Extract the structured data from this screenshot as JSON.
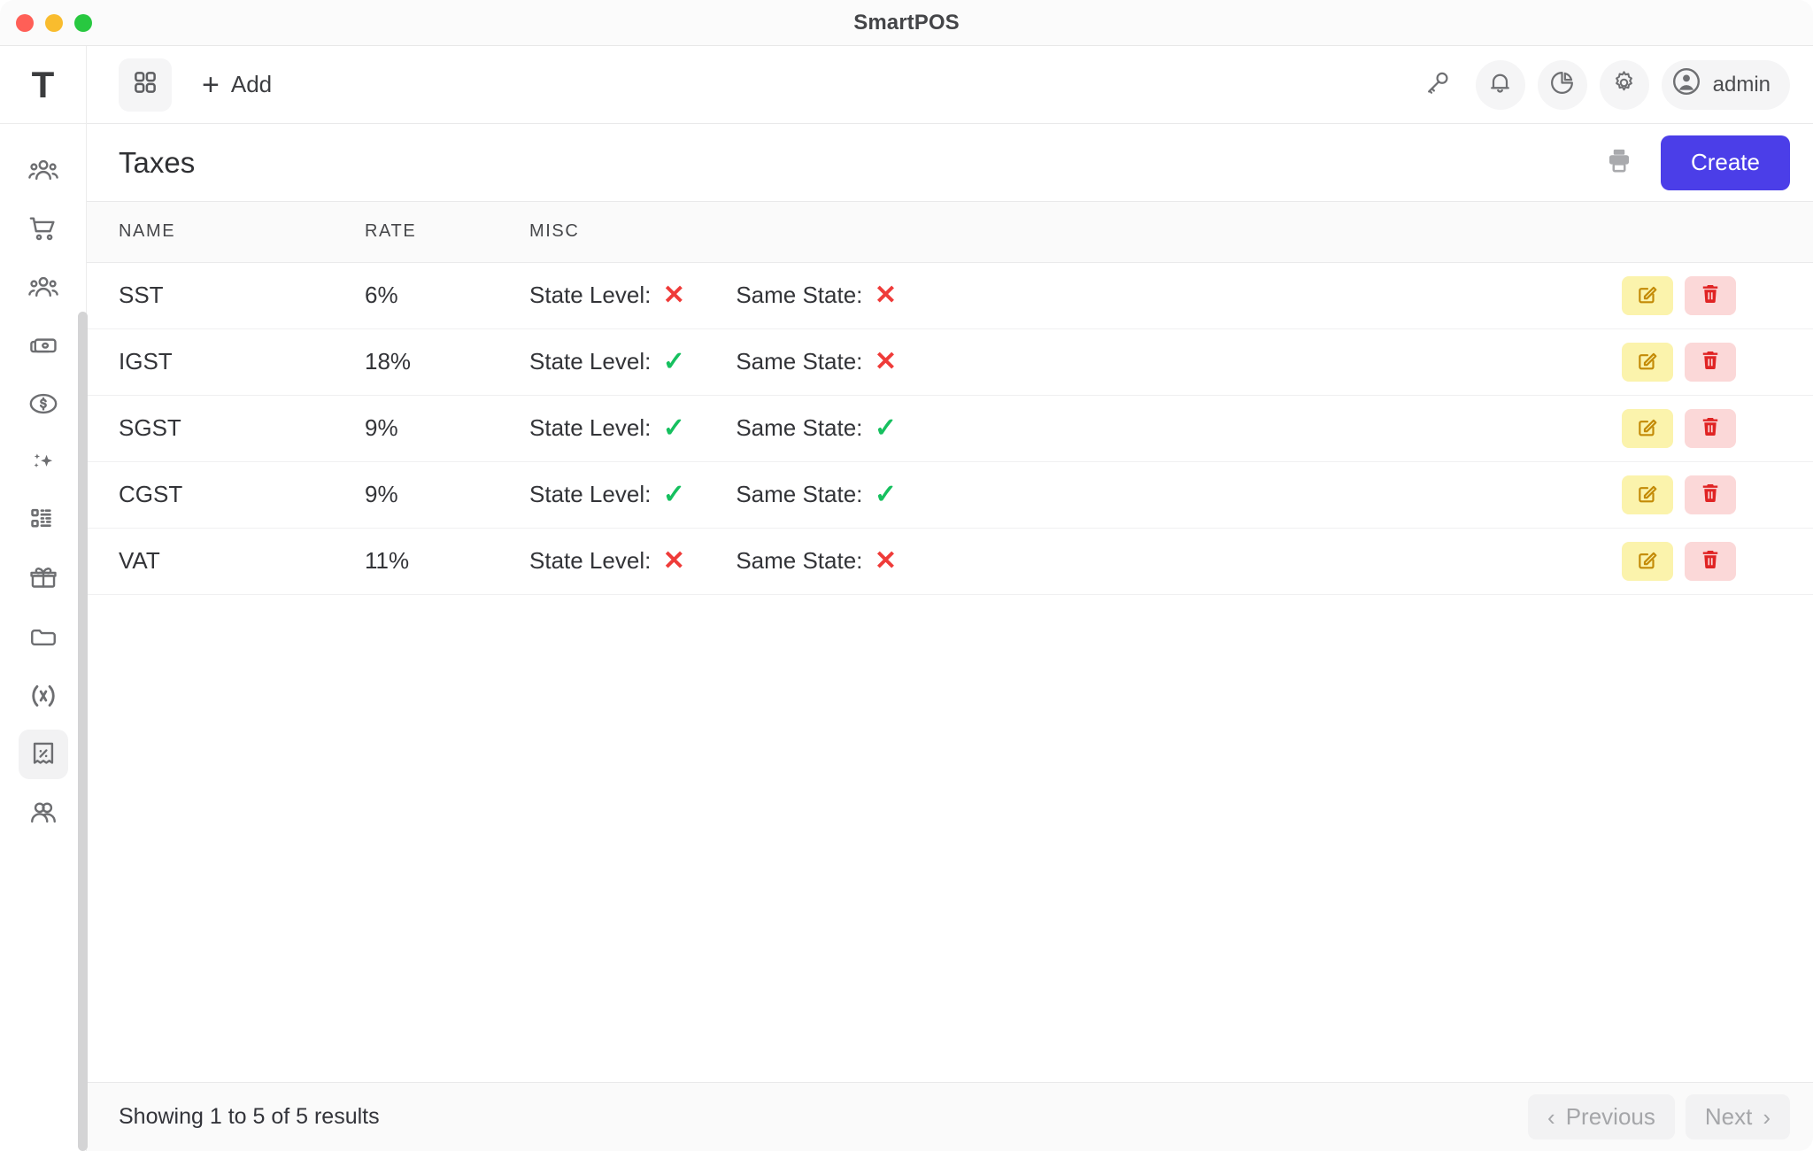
{
  "window": {
    "title": "SmartPOS",
    "traffic_lights": [
      "close",
      "minimize",
      "maximize"
    ]
  },
  "sidebar": {
    "brand": "T",
    "items": [
      {
        "name": "customers-group",
        "icon": "users-group-icon",
        "active": false
      },
      {
        "name": "orders",
        "icon": "shopping-cart-icon",
        "active": false
      },
      {
        "name": "staff",
        "icon": "users-group-icon",
        "active": false
      },
      {
        "name": "cash",
        "icon": "banknotes-icon",
        "active": false
      },
      {
        "name": "currency",
        "icon": "dollar-coin-icon",
        "active": false
      },
      {
        "name": "promotions",
        "icon": "sparkles-icon",
        "active": false
      },
      {
        "name": "barcodes",
        "icon": "qr-code-icon",
        "active": false
      },
      {
        "name": "gift-cards",
        "icon": "gift-icon",
        "active": false
      },
      {
        "name": "files",
        "icon": "folder-icon",
        "active": false
      },
      {
        "name": "variables",
        "icon": "function-icon",
        "active": false
      },
      {
        "name": "taxes",
        "icon": "receipt-percent-icon",
        "active": true
      },
      {
        "name": "suppliers",
        "icon": "users-duo-icon",
        "active": false
      }
    ]
  },
  "toolbar": {
    "grid_icon": "grid-apps-icon",
    "add_label": "Add",
    "add_icon": "plus-icon",
    "icons": [
      {
        "name": "key-icon",
        "filled": false
      },
      {
        "name": "bell-icon",
        "filled": true
      },
      {
        "name": "pie-chart-icon",
        "filled": true
      },
      {
        "name": "gear-icon",
        "filled": true
      }
    ],
    "user": {
      "label": "admin",
      "icon": "user-circle-icon"
    }
  },
  "page": {
    "title": "Taxes",
    "print_icon": "printer-icon",
    "create_label": "Create"
  },
  "table": {
    "columns": [
      "NAME",
      "RATE",
      "MISC",
      ""
    ],
    "misc_labels": {
      "state_level": "State Level:",
      "same_state": "Same State:"
    },
    "marks": {
      "yes": "✓",
      "no": "✕"
    },
    "actions": {
      "edit_icon": "pencil-square-icon",
      "delete_icon": "trash-icon"
    },
    "rows": [
      {
        "name": "SST",
        "rate": "6%",
        "state_level": false,
        "same_state": false
      },
      {
        "name": "IGST",
        "rate": "18%",
        "state_level": true,
        "same_state": false
      },
      {
        "name": "SGST",
        "rate": "9%",
        "state_level": true,
        "same_state": true
      },
      {
        "name": "CGST",
        "rate": "9%",
        "state_level": true,
        "same_state": true
      },
      {
        "name": "VAT",
        "rate": "11%",
        "state_level": false,
        "same_state": false
      }
    ]
  },
  "footer": {
    "results_text": "Showing 1 to 5 of 5 results",
    "previous_label": "Previous",
    "next_label": "Next",
    "previous_chevron": "‹",
    "next_chevron": "›"
  },
  "colors": {
    "accent": "#4b3ee8",
    "success": "#16c05f",
    "danger": "#ef3b39",
    "edit_bg": "#fbf3ac",
    "edit_fg": "#c38a06",
    "delete_bg": "#fbd8d8",
    "delete_fg": "#e02424"
  }
}
